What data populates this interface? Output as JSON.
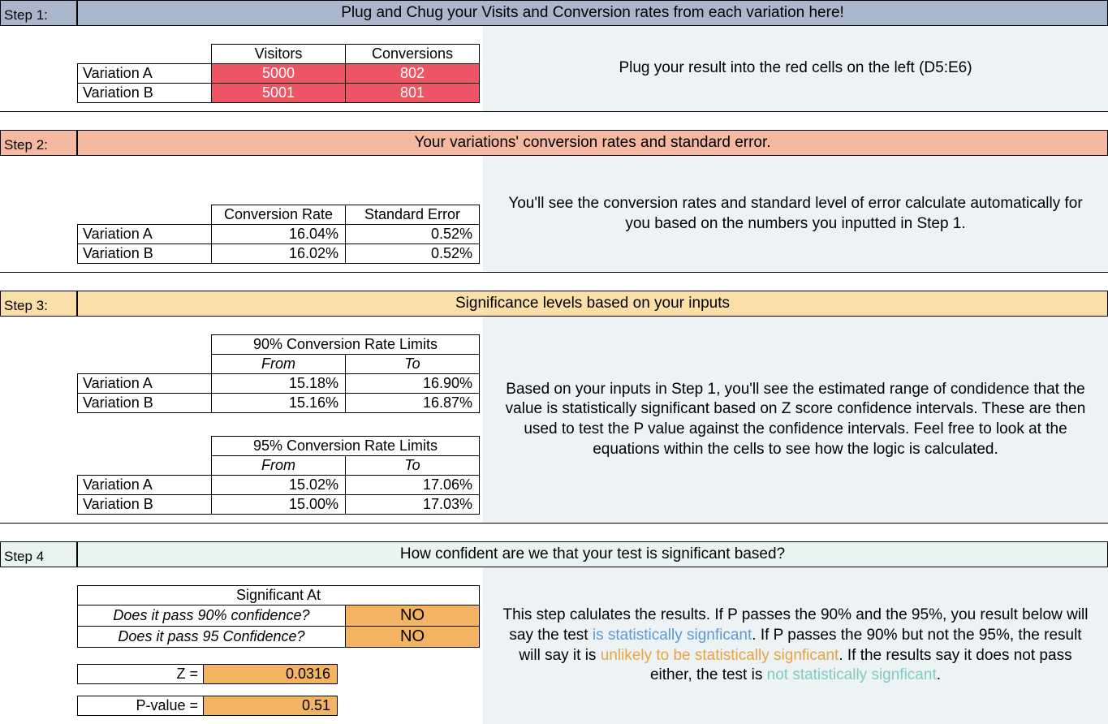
{
  "step1": {
    "label": "Step 1:",
    "banner": "Plug and Chug your Visits and Conversion rates from each variation here!",
    "headers": {
      "visitors": "Visitors",
      "conversions": "Conversions"
    },
    "rows": [
      {
        "name": "Variation A",
        "visitors": "5000",
        "conversions": "802"
      },
      {
        "name": "Variation B",
        "visitors": "5001",
        "conversions": "801"
      }
    ],
    "desc": "Plug your result into the red cells on the left (D5:E6)"
  },
  "step2": {
    "label": "Step 2:",
    "banner": "Your variations' conversion rates and standard error.",
    "headers": {
      "rate": "Conversion Rate",
      "se": "Standard Error"
    },
    "rows": [
      {
        "name": "Variation A",
        "rate": "16.04%",
        "se": "0.52%"
      },
      {
        "name": "Variation B",
        "rate": "16.02%",
        "se": "0.52%"
      }
    ],
    "desc": "You'll see the conversion rates and standard level of error calculate automatically for you based on the numbers you inputted in Step 1."
  },
  "step3": {
    "label": "Step 3:",
    "banner": "Significance levels based on your inputs",
    "limits90": {
      "title": "90% Conversion Rate Limits",
      "from": "From",
      "to": "To",
      "rows": [
        {
          "name": "Variation A",
          "from": "15.18%",
          "to": "16.90%"
        },
        {
          "name": "Variation B",
          "from": "15.16%",
          "to": "16.87%"
        }
      ]
    },
    "limits95": {
      "title": "95% Conversion Rate Limits",
      "from": "From",
      "to": "To",
      "rows": [
        {
          "name": "Variation A",
          "from": "15.02%",
          "to": "17.06%"
        },
        {
          "name": "Variation B",
          "from": "15.00%",
          "to": "17.03%"
        }
      ]
    },
    "desc": "Based on your inputs in Step 1, you'll see the estimated range of condidence that the value is statistically significant based on Z score confidence intervals. These are then used to test the P value against the confidence intervals. Feel free to look at the equations within the cells to see how the logic is calculated."
  },
  "step4": {
    "label": "Step 4",
    "banner": "How confident are we that your test is significant based?",
    "sig_title": "Significant At",
    "q90": "Does it pass 90% confidence?",
    "q95": "Does it pass 95 Confidence?",
    "a90": "NO",
    "a95": "NO",
    "z_label": "Z =",
    "z_val": "0.0316",
    "p_label": "P-value =",
    "p_val": "0.51",
    "desc_parts": {
      "p1": "This step calulates the results. If P passes the 90% and the 95%, you result below will say the test ",
      "sig": "is statistically signficant",
      "p2": ". If P passes the 90% but not the 95%, the result will say it is ",
      "unlikely": "unlikely to be statistically signficant",
      "p3": ". If the results say it does not pass either, the test is ",
      "notsig": "not statistically signficant",
      "p4": "."
    }
  }
}
